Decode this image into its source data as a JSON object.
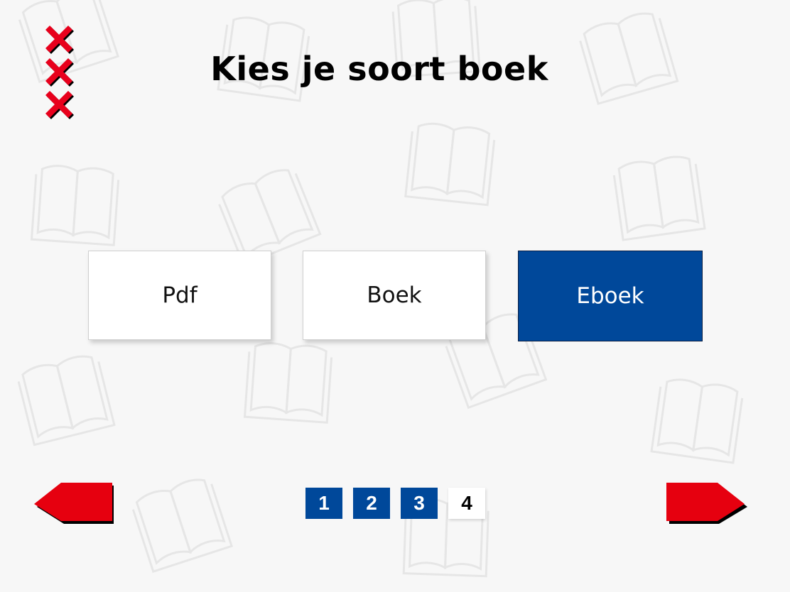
{
  "header": {
    "title": "Kies je soort boek"
  },
  "choices": [
    {
      "label": "Pdf",
      "selected": false
    },
    {
      "label": "Boek",
      "selected": false
    },
    {
      "label": "Eboek",
      "selected": true
    }
  ],
  "pagination": {
    "pages": [
      "1",
      "2",
      "3",
      "4"
    ],
    "current": "4"
  },
  "colors": {
    "accent_blue": "#00489a",
    "arrow_red": "#e6000f",
    "logo_red": "#e8001c",
    "background": "#f7f7f7"
  },
  "icons": {
    "logo": "andreas-cross-logo-icon",
    "previous": "arrow-left-icon",
    "next": "arrow-right-icon",
    "background_pattern": "open-book-icon"
  }
}
